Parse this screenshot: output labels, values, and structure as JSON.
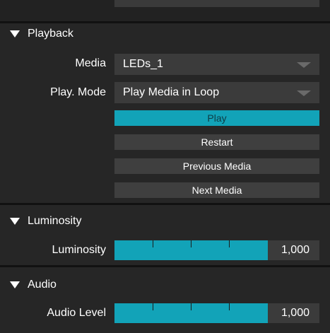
{
  "playback": {
    "title": "Playback",
    "media_label": "Media",
    "media_value": "LEDs_1",
    "mode_label": "Play. Mode",
    "mode_value": "Play Media in Loop",
    "buttons": {
      "play": "Play",
      "restart": "Restart",
      "previous": "Previous Media",
      "next": "Next Media"
    }
  },
  "luminosity": {
    "title": "Luminosity",
    "label": "Luminosity",
    "value": "1,000",
    "level_fraction": 1.0
  },
  "audio": {
    "title": "Audio",
    "label": "Audio Level",
    "value": "1,000",
    "level_fraction": 1.0
  },
  "colors": {
    "accent": "#12a3b8",
    "panel": "#262626",
    "control": "#3b3b3b"
  },
  "icons": {
    "section_toggle": "triangle-down-icon",
    "dropdown": "chevron-down-icon"
  }
}
